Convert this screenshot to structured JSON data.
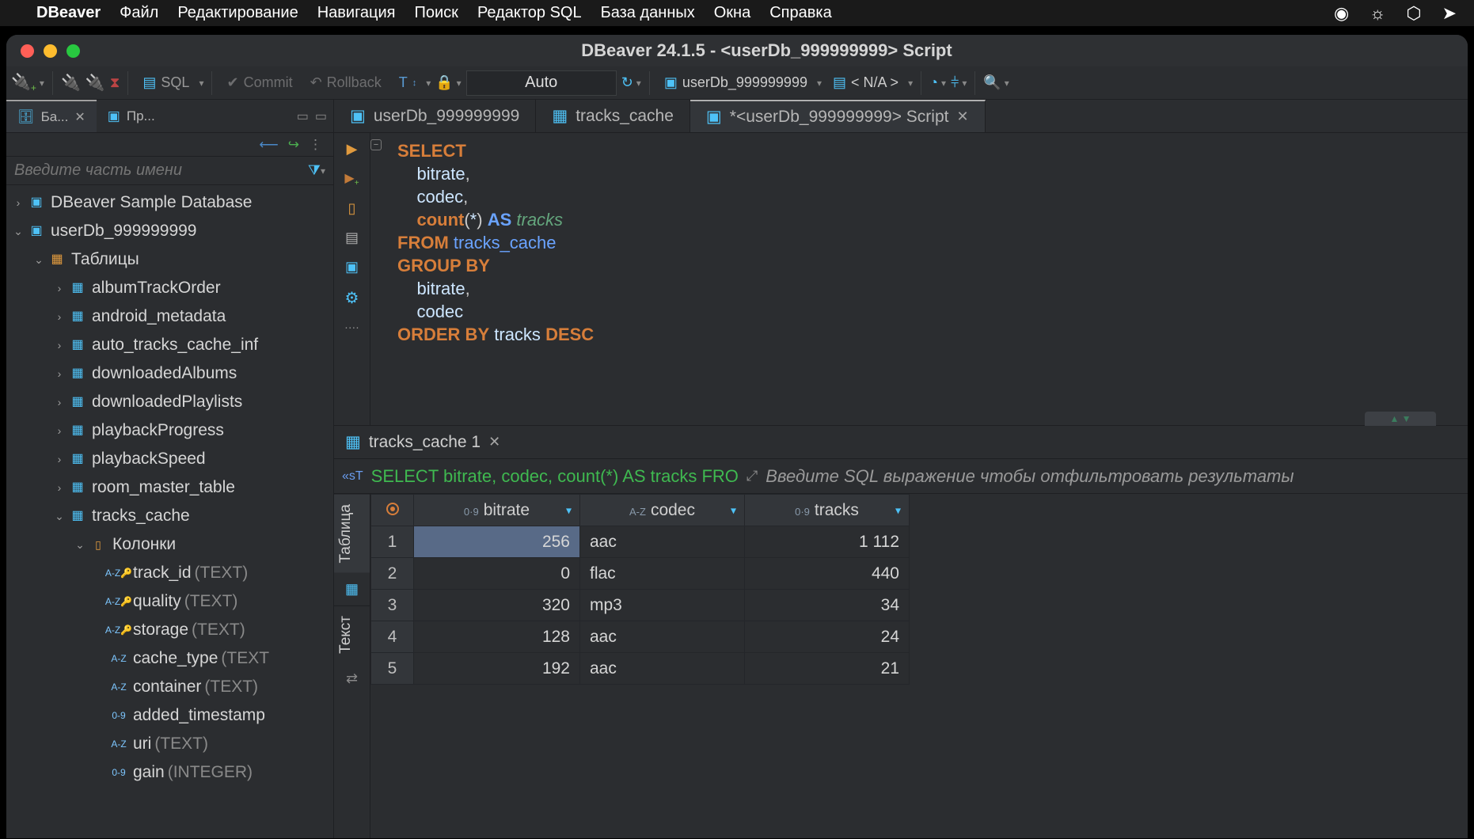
{
  "macos": {
    "app_name": "DBeaver",
    "menus": [
      "Файл",
      "Редактирование",
      "Навигация",
      "Поиск",
      "Редактор SQL",
      "База данных",
      "Окна",
      "Справка"
    ]
  },
  "window_title": "DBeaver 24.1.5 - <userDb_999999999> Script",
  "toolbar": {
    "sql_label": "SQL",
    "commit_label": "Commit",
    "rollback_label": "Rollback",
    "mode": "Auto",
    "datasource": "userDb_999999999",
    "schema": "< N/A >"
  },
  "left_panel": {
    "tab1": "Ба...",
    "tab2": "Пр...",
    "filter_placeholder": "Введите часть имени",
    "tree": {
      "db1": "DBeaver Sample Database",
      "db2": "userDb_999999999",
      "folder_tables": "Таблицы",
      "tables": [
        "albumTrackOrder",
        "android_metadata",
        "auto_tracks_cache_inf",
        "downloadedAlbums",
        "downloadedPlaylists",
        "playbackProgress",
        "playbackSpeed",
        "room_master_table",
        "tracks_cache"
      ],
      "columns_folder": "Колонки",
      "columns": [
        {
          "name": "track_id",
          "type": "(TEXT)",
          "kind": "az-key"
        },
        {
          "name": "quality",
          "type": "(TEXT)",
          "kind": "az-key"
        },
        {
          "name": "storage",
          "type": "(TEXT)",
          "kind": "az-key"
        },
        {
          "name": "cache_type",
          "type": "(TEXT",
          "kind": "az"
        },
        {
          "name": "container",
          "type": "(TEXT)",
          "kind": "az"
        },
        {
          "name": "added_timestamp",
          "type": "",
          "kind": "09"
        },
        {
          "name": "uri",
          "type": "(TEXT)",
          "kind": "az"
        },
        {
          "name": "gain",
          "type": "(INTEGER)",
          "kind": "09"
        }
      ]
    }
  },
  "editor": {
    "tab1": "userDb_999999999",
    "tab2": "tracks_cache",
    "tab3": "*<userDb_999999999> Script",
    "sql_lines": [
      {
        "indent": 0,
        "parts": [
          {
            "t": "SELECT",
            "c": "kwd"
          }
        ]
      },
      {
        "indent": 1,
        "parts": [
          {
            "t": "bitrate",
            "c": "id"
          },
          {
            "t": ",",
            "c": ""
          }
        ]
      },
      {
        "indent": 1,
        "parts": [
          {
            "t": "codec",
            "c": "id"
          },
          {
            "t": ",",
            "c": ""
          }
        ]
      },
      {
        "indent": 1,
        "parts": [
          {
            "t": "count",
            "c": "fn"
          },
          {
            "t": "(",
            "c": ""
          },
          {
            "t": "*",
            "c": "star"
          },
          {
            "t": ") ",
            "c": ""
          },
          {
            "t": "AS",
            "c": "as"
          },
          {
            "t": " ",
            "c": ""
          },
          {
            "t": "tracks",
            "c": "alias"
          }
        ]
      },
      {
        "indent": 0,
        "parts": [
          {
            "t": "FROM",
            "c": "plainkw"
          },
          {
            "t": " ",
            "c": ""
          },
          {
            "t": "tracks_cache",
            "c": "tbl"
          }
        ]
      },
      {
        "indent": 0,
        "parts": [
          {
            "t": "GROUP BY",
            "c": "plainkw"
          }
        ]
      },
      {
        "indent": 1,
        "parts": [
          {
            "t": "bitrate",
            "c": "id"
          },
          {
            "t": ",",
            "c": ""
          }
        ]
      },
      {
        "indent": 1,
        "parts": [
          {
            "t": "codec",
            "c": "id"
          }
        ]
      },
      {
        "indent": 0,
        "parts": [
          {
            "t": "ORDER BY",
            "c": "plainkw"
          },
          {
            "t": " ",
            "c": ""
          },
          {
            "t": "tracks",
            "c": "id"
          },
          {
            "t": " ",
            "c": ""
          },
          {
            "t": "DESC",
            "c": "plainkw"
          }
        ]
      }
    ]
  },
  "results": {
    "tab": "tracks_cache 1",
    "sql_preview": "SELECT bitrate, codec, count(*) AS tracks FRO",
    "filter_placeholder": "Введите SQL выражение чтобы отфильтровать результаты",
    "vtab_table": "Таблица",
    "vtab_text": "Текст",
    "columns": [
      {
        "name": "bitrate",
        "prefix": "0·9"
      },
      {
        "name": "codec",
        "prefix": "A-Z"
      },
      {
        "name": "tracks",
        "prefix": "0·9"
      }
    ],
    "rows": [
      {
        "n": 1,
        "bitrate": "256",
        "codec": "aac",
        "tracks": "1 112"
      },
      {
        "n": 2,
        "bitrate": "0",
        "codec": "flac",
        "tracks": "440"
      },
      {
        "n": 3,
        "bitrate": "320",
        "codec": "mp3",
        "tracks": "34"
      },
      {
        "n": 4,
        "bitrate": "128",
        "codec": "aac",
        "tracks": "24"
      },
      {
        "n": 5,
        "bitrate": "192",
        "codec": "aac",
        "tracks": "21"
      }
    ]
  }
}
